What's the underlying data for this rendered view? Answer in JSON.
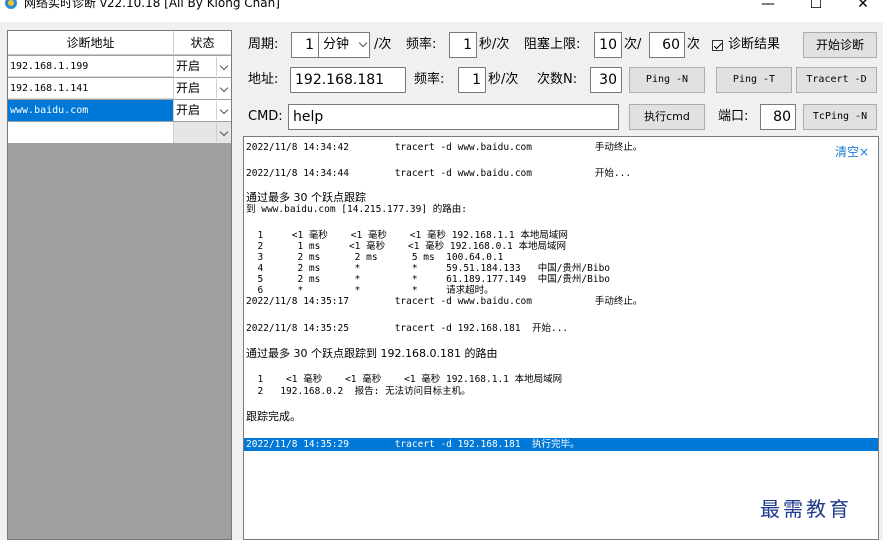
{
  "window": {
    "title": "网络实时诊断 v22.10.18 [All By Kiong Chan]",
    "minimize": "—",
    "maximize": "☐",
    "close": "✕"
  },
  "table": {
    "header_address": "诊断地址",
    "header_state": "状态",
    "rows": [
      {
        "address": "192.168.1.199",
        "state": "开启",
        "selected": false
      },
      {
        "address": "192.168.1.141",
        "state": "开启",
        "selected": false
      },
      {
        "address": "www.baidu.com",
        "state": "开启",
        "selected": true
      },
      {
        "address": "",
        "state": "",
        "selected": false
      }
    ]
  },
  "row1": {
    "period_label": "周期:",
    "period_value": "1",
    "period_unit": "分钟",
    "per_time": "/次",
    "freq_label": "频率:",
    "freq_value": "1",
    "freq_unit": "秒/次",
    "block_label": "阻塞上限:",
    "block_value": "10",
    "block_unit": "次/",
    "block_value2": "60",
    "block_unit2": "次",
    "result_check_label": "诊断结果",
    "start_button": "开始诊断"
  },
  "row2": {
    "addr_label": "地址:",
    "addr_value": "192.168.181",
    "freq_label": "频率:",
    "freq_value": "1",
    "freq_unit": "秒/次",
    "count_label": "次数N:",
    "count_value": "30",
    "ping_n": "Ping -N",
    "ping_t": "Ping -T",
    "tracert_d": "Tracert -D"
  },
  "row3": {
    "cmd_label": "CMD:",
    "cmd_value": "help",
    "exec_button": "执行cmd",
    "port_label": "端口:",
    "port_value": "80",
    "tcping_button": "TcPing -N"
  },
  "log": {
    "clear_label": "清空×",
    "lines": [
      "2022/11/8 14:34:42        tracert -d www.baidu.com           手动终止。",
      "2022/11/8 14:34:44        tracert -d www.baidu.com           开始...",
      "通过最多 30 个跃点跟踪",
      "到 www.baidu.com [14.215.177.39] 的路由:",
      "  1     <1 毫秒    <1 毫秒    <1 毫秒 192.168.1.1 本地局域网",
      "  2      1 ms     <1 毫秒    <1 毫秒 192.168.0.1 本地局域网",
      "  3      2 ms      2 ms      5 ms  100.64.0.1",
      "  4      2 ms      *         *     59.51.184.133   中国/贵州/Bibo",
      "  5      2 ms      *         *     61.189.177.149  中国/贵州/Bibo",
      "  6      *         *         *     请求超时。",
      "2022/11/8 14:35:17        tracert -d www.baidu.com           手动终止。",
      "2022/11/8 14:35:25        tracert -d 192.168.181  开始...",
      "通过最多 30 个跃点跟踪到 192.168.0.181 的路由",
      "  1    <1 毫秒    <1 毫秒    <1 毫秒 192.168.1.1 本地局域网",
      "  2   192.168.0.2  报告: 无法访问目标主机。",
      "跟踪完成。",
      "2022/11/8 14:35:29        tracert -d 192.168.181  执行完毕。"
    ],
    "highlighted_index": 16
  },
  "watermark": "最需教育"
}
